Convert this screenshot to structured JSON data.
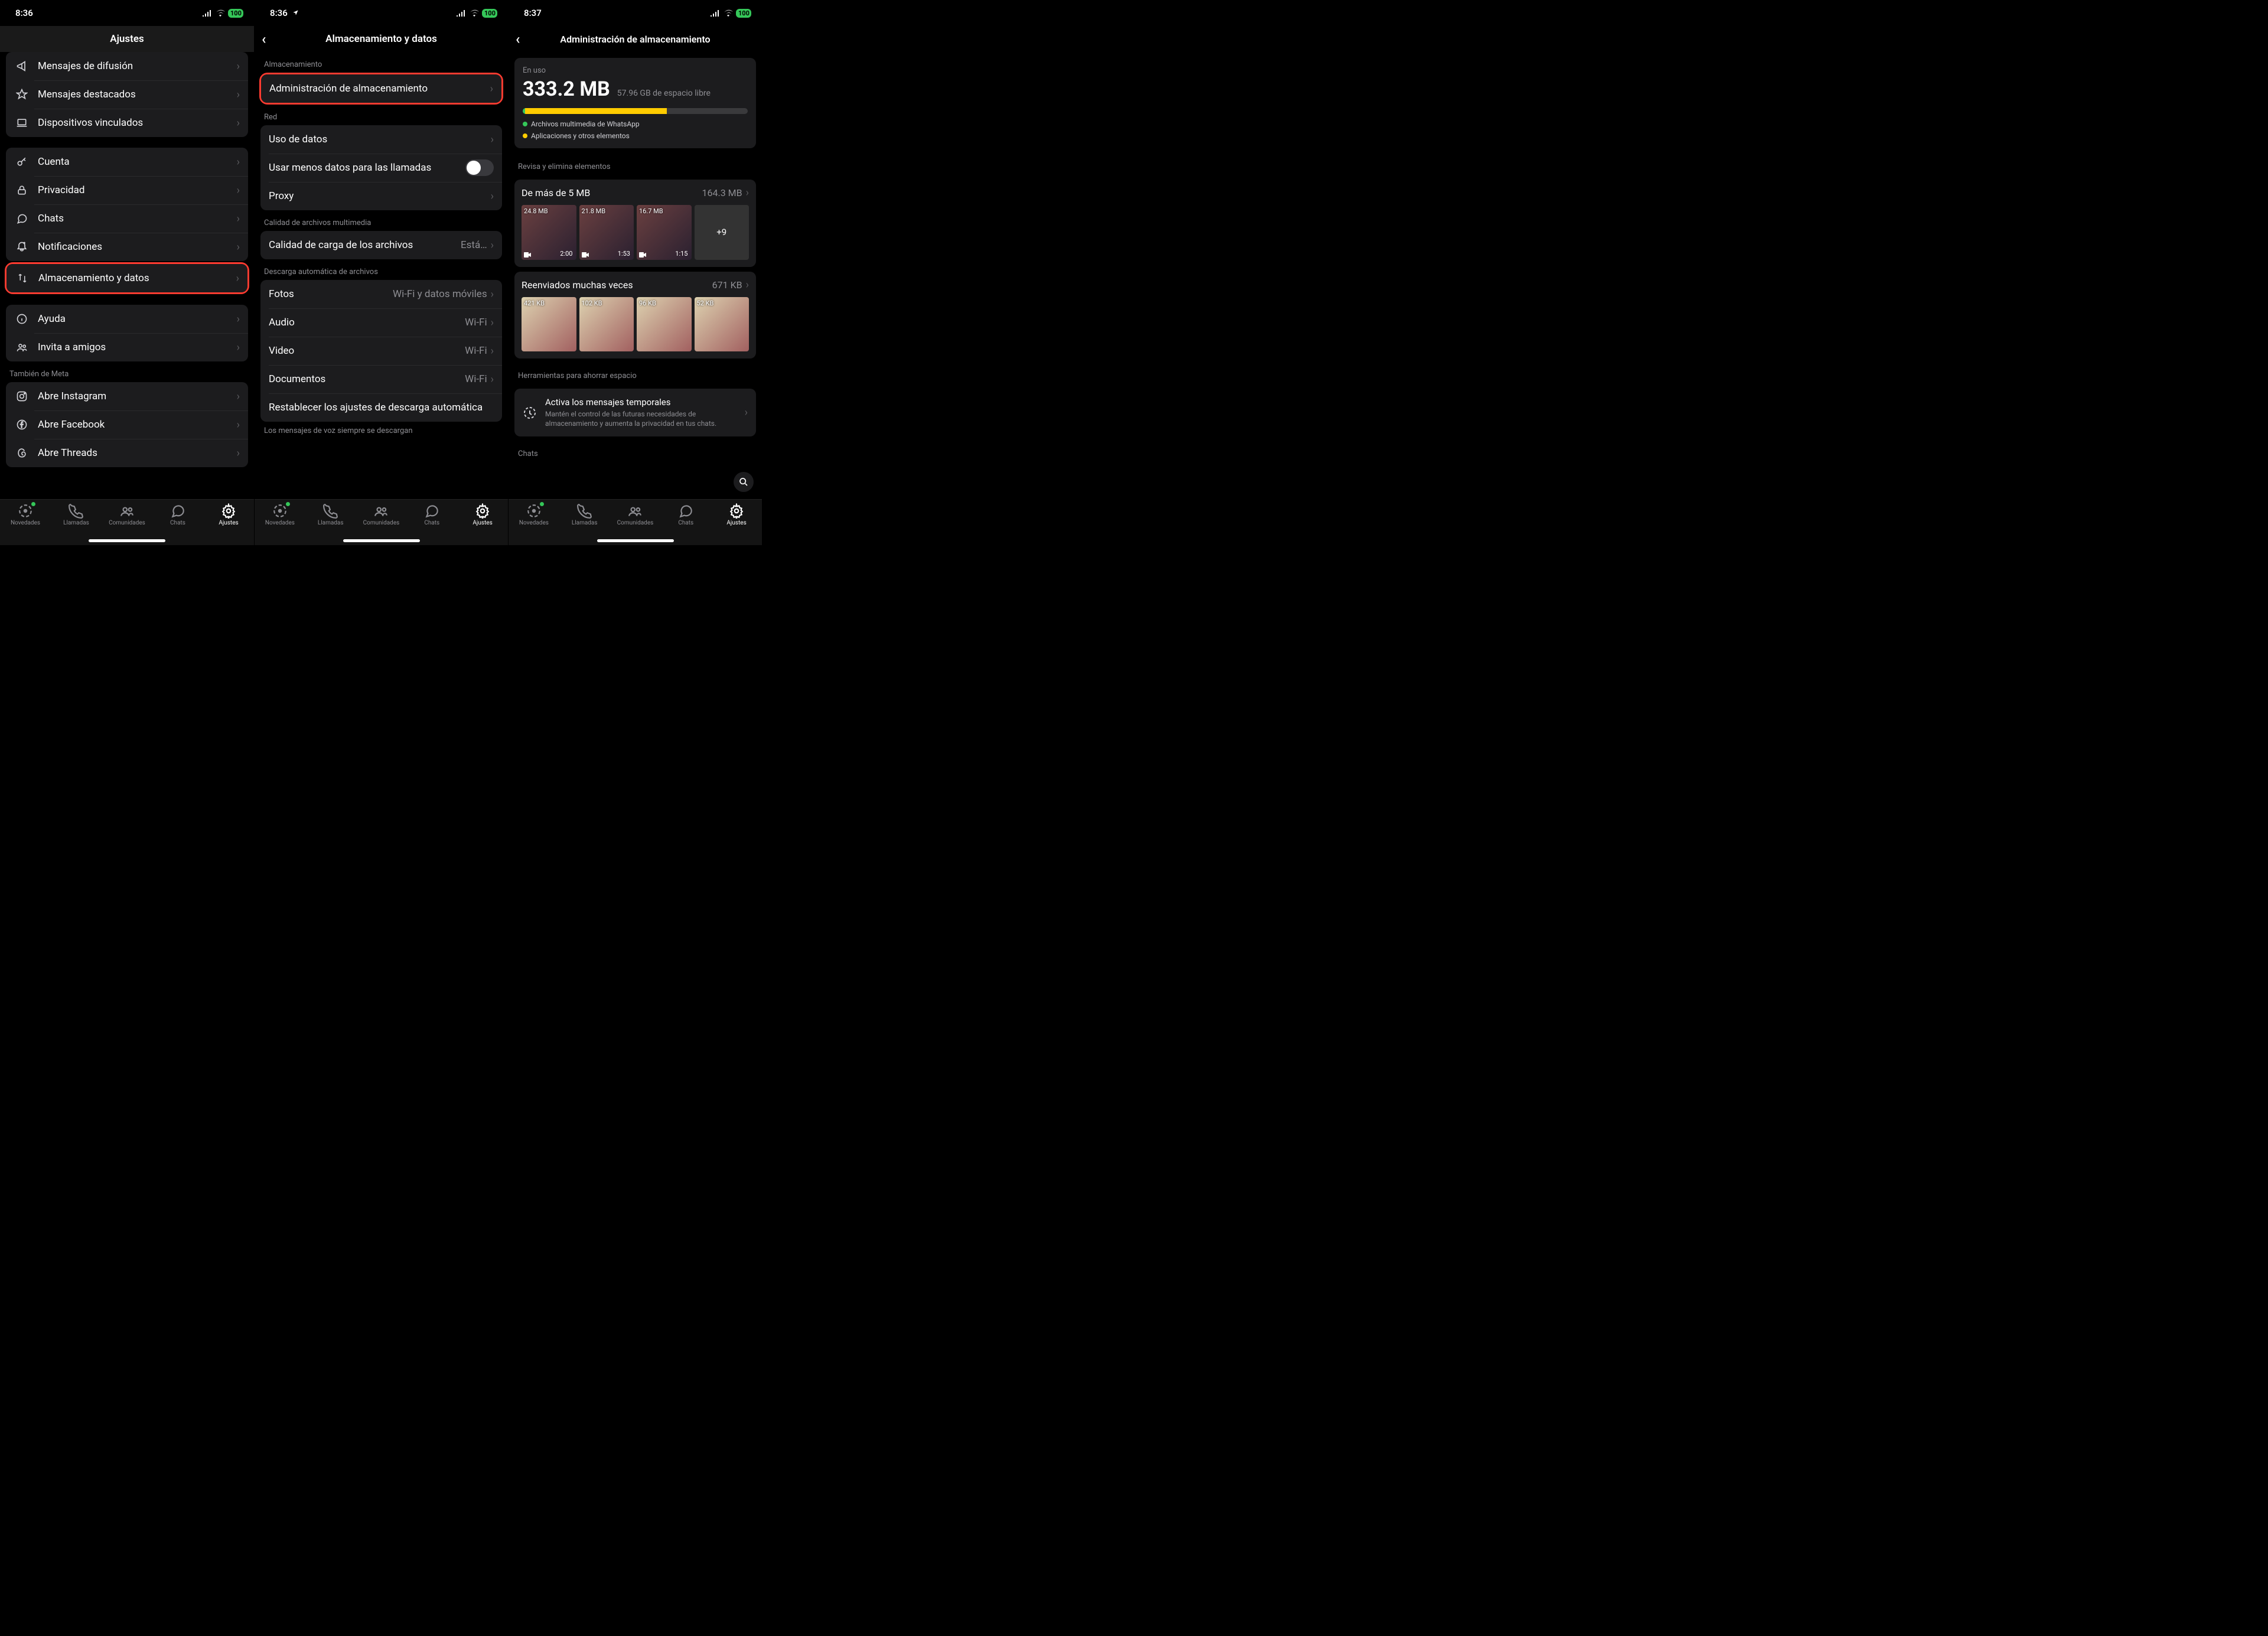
{
  "tabs": [
    "Novedades",
    "Llamadas",
    "Comunidades",
    "Chats",
    "Ajustes"
  ],
  "battery": "100",
  "screen1": {
    "time": "8:36",
    "title": "Ajustes",
    "group1": [
      {
        "icon": "megaphone",
        "label": "Mensajes de difusión"
      },
      {
        "icon": "star",
        "label": "Mensajes destacados"
      },
      {
        "icon": "laptop",
        "label": "Dispositivos vinculados"
      }
    ],
    "group2": [
      {
        "icon": "key",
        "label": "Cuenta"
      },
      {
        "icon": "lock",
        "label": "Privacidad"
      },
      {
        "icon": "chat",
        "label": "Chats"
      },
      {
        "icon": "bell",
        "label": "Notificaciones"
      }
    ],
    "highlight": {
      "icon": "updown",
      "label": "Almacenamiento y datos"
    },
    "group3": [
      {
        "icon": "info",
        "label": "Ayuda"
      },
      {
        "icon": "people",
        "label": "Invita a amigos"
      }
    ],
    "meta_header": "También de Meta",
    "group4": [
      {
        "icon": "instagram",
        "label": "Abre Instagram"
      },
      {
        "icon": "facebook",
        "label": "Abre Facebook"
      },
      {
        "icon": "threads",
        "label": "Abre Threads"
      }
    ]
  },
  "screen2": {
    "time": "8:36",
    "title": "Almacenamiento y datos",
    "sec_storage": "Almacenamiento",
    "highlight": {
      "label": "Administración de almacenamiento"
    },
    "sec_network": "Red",
    "net_rows": [
      {
        "label": "Uso de datos",
        "type": "chev"
      },
      {
        "label": "Usar menos datos para las llamadas",
        "type": "toggle",
        "on": false
      },
      {
        "label": "Proxy",
        "type": "chev"
      }
    ],
    "sec_quality": "Calidad de archivos multimedia",
    "quality_row": {
      "label": "Calidad de carga de los archivos",
      "value": "Está…"
    },
    "sec_auto": "Descarga automática de archivos",
    "auto_rows": [
      {
        "label": "Fotos",
        "value": "Wi-Fi y datos móviles"
      },
      {
        "label": "Audio",
        "value": "Wi-Fi"
      },
      {
        "label": "Video",
        "value": "Wi-Fi"
      },
      {
        "label": "Documentos",
        "value": "Wi-Fi"
      },
      {
        "label": "Restablecer los ajustes de descarga automática",
        "type": "plain"
      }
    ],
    "auto_footer": "Los mensajes de voz siempre se descargan"
  },
  "screen3": {
    "time": "8:37",
    "title": "Administración de almacenamiento",
    "inuse_label": "En uso",
    "inuse": "333.2 MB",
    "free": "57.96 GB de espacio libre",
    "legend_wa": "Archivos multimedia de WhatsApp",
    "legend_other": "Aplicaciones y otros elementos",
    "review_header": "Revisa y elimina elementos",
    "cat1": {
      "title": "De más de 5 MB",
      "size": "164.3 MB",
      "thumbs": [
        {
          "size": "24.8 MB",
          "dur": "2:00",
          "video": true
        },
        {
          "size": "21.8 MB",
          "dur": "1:53",
          "video": true
        },
        {
          "size": "16.7 MB",
          "dur": "1:15",
          "video": true
        }
      ],
      "more": "+9"
    },
    "cat2": {
      "title": "Reenviados muchas veces",
      "size": "671 KB",
      "thumbs": [
        {
          "size": "421 KB"
        },
        {
          "size": "102 KB"
        },
        {
          "size": "96 KB"
        },
        {
          "size": "52 KB"
        }
      ]
    },
    "tools_header": "Herramientas para ahorrar espacio",
    "tool": {
      "title": "Activa los mensajes temporales",
      "sub": "Mantén el control de las futuras necesidades de almacenamiento y aumenta la privacidad en tus chats."
    },
    "chats_header": "Chats"
  }
}
